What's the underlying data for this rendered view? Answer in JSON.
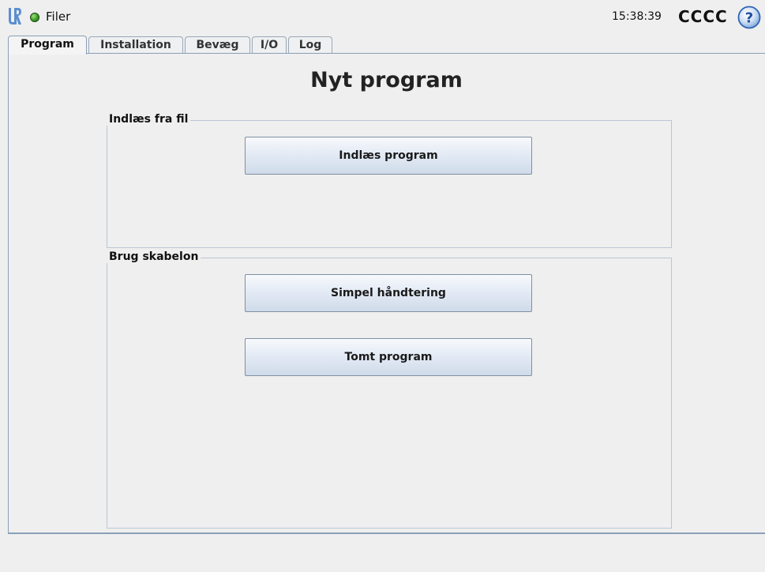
{
  "header": {
    "menu_title": "Filer",
    "clock": "15:38:39",
    "robot_name": "CCCC",
    "status_color": "#3e9a2a",
    "logo_icon": "universal-robots-logo",
    "help_icon": "question-mark-icon"
  },
  "tabs": [
    {
      "label": "Program",
      "active": true
    },
    {
      "label": "Installation",
      "active": false
    },
    {
      "label": "Bevæg",
      "active": false
    },
    {
      "label": "I/O",
      "active": false
    },
    {
      "label": "Log",
      "active": false
    }
  ],
  "main": {
    "title": "Nyt program",
    "load_group": {
      "legend": "Indlæs fra fil",
      "load_button": "Indlæs program"
    },
    "template_group": {
      "legend": "Brug skabelon",
      "simple_button": "Simpel håndtering",
      "empty_button": "Tomt program"
    }
  },
  "colors": {
    "accent": "#8aa0b8",
    "background": "#efefef",
    "button_gradient_top": "#f7f9fc",
    "button_gradient_bottom": "#cfdbea"
  }
}
